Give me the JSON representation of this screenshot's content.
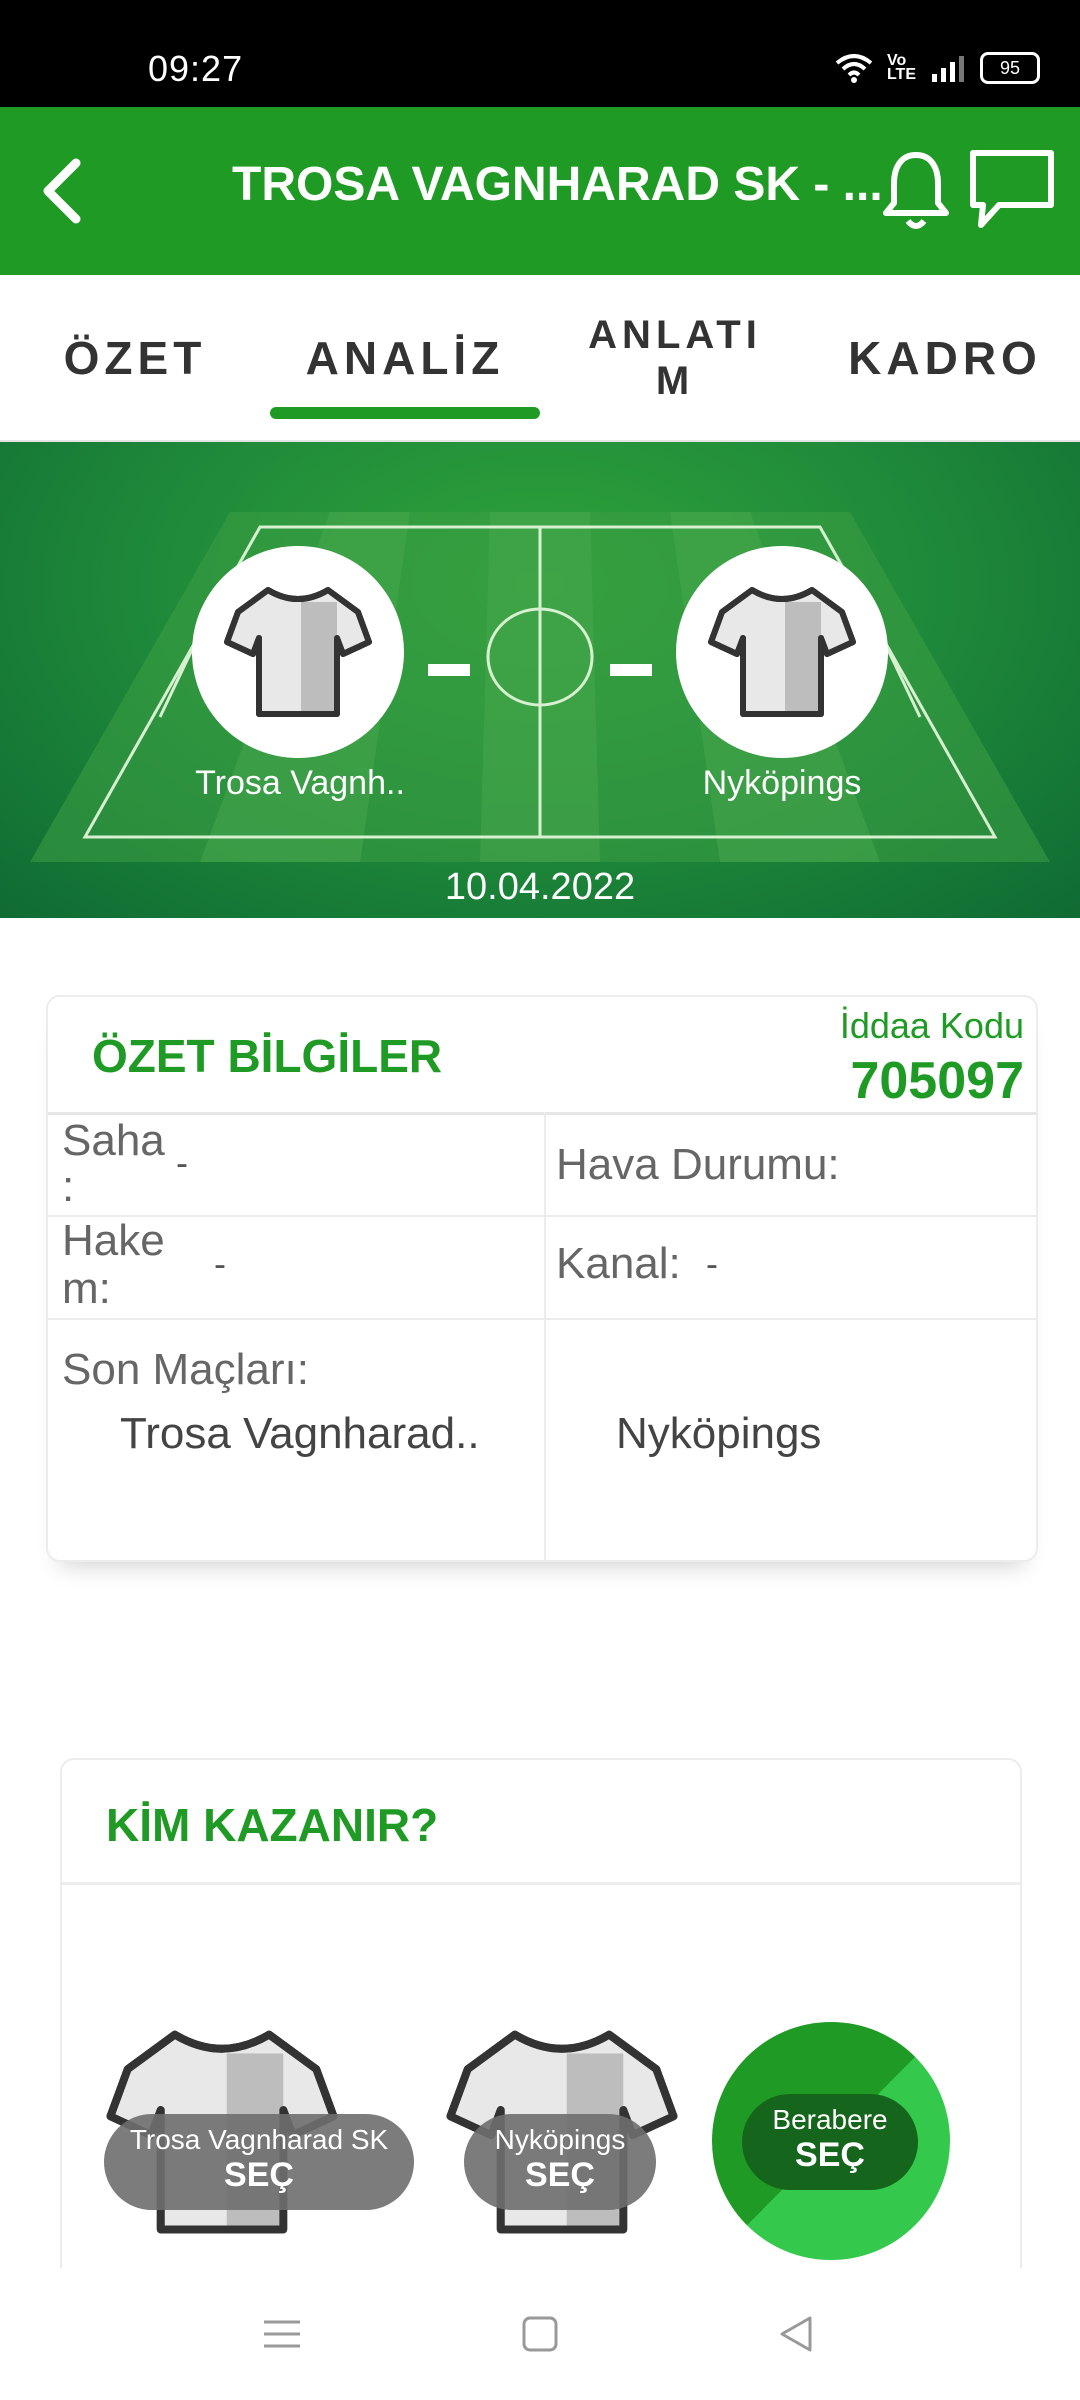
{
  "status": {
    "time": "09:27",
    "battery": "95"
  },
  "header": {
    "title": "TROSA VAGNHARAD SK - ..."
  },
  "tabs": [
    {
      "label": "ÖZET"
    },
    {
      "label": "ANALİZ"
    },
    {
      "label": "ANLATI M"
    },
    {
      "label": "KADRO"
    }
  ],
  "match": {
    "home_team": "Trosa Vagnh..",
    "away_team": "Nyköpings",
    "date": "10.04.2022"
  },
  "summary": {
    "title": "ÖZET BİLGİLER",
    "code_label": "İddaa Kodu",
    "code_value": "705097",
    "saha_label": "Saha :",
    "saha_value": "-",
    "hava_label": "Hava Durumu:",
    "hakem_label": "Hake m:",
    "hakem_value": "-",
    "kanal_label": "Kanal:",
    "kanal_value": "-",
    "son_label": "Son Maçları:",
    "home_name": "Trosa Vagnharad..",
    "away_name": "Nyköpings"
  },
  "predict": {
    "title": "KİM KAZANIR?",
    "options": [
      {
        "name": "Trosa Vagnharad SK",
        "action": "SEÇ"
      },
      {
        "name": "Nyköpings",
        "action": "SEÇ"
      },
      {
        "name": "Berabere",
        "action": "SEÇ"
      }
    ]
  },
  "colors": {
    "primary": "#1f9b25",
    "field_dark": "#0f6b33"
  }
}
